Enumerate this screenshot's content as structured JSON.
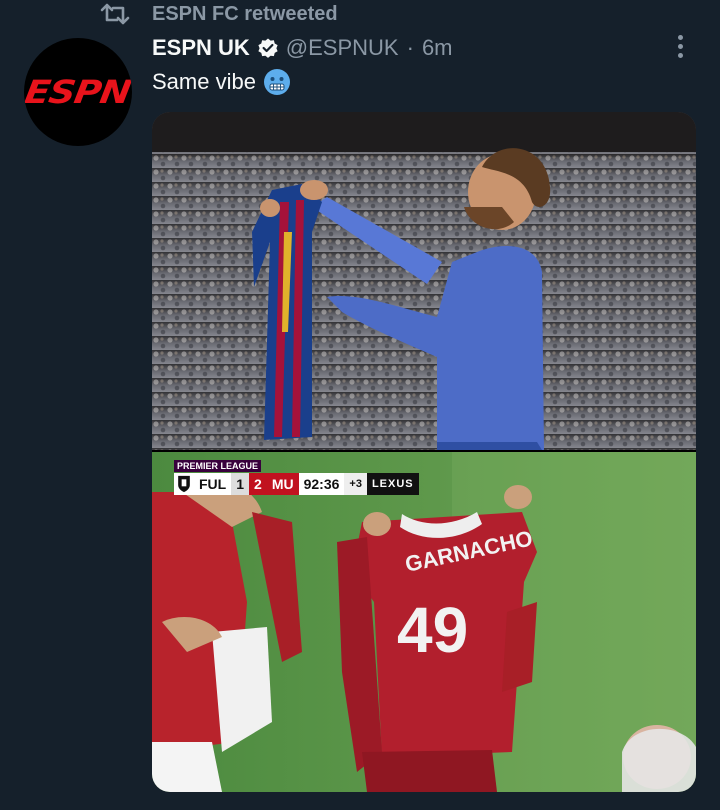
{
  "retweet": {
    "label": "ESPN FC retweeted"
  },
  "author": {
    "avatar_text": "ESPN",
    "display_name": "ESPN UK",
    "handle": "@ESPNUK",
    "separator": "·",
    "time": "6m"
  },
  "tweet": {
    "text": "Same vibe",
    "emoji": "cold-face-emoji"
  },
  "scoreboard": {
    "league": "PREMIER LEAGUE",
    "home": "FUL",
    "home_score": "1",
    "away_score": "2",
    "away": "MU",
    "clock": "92:36",
    "added": "+3",
    "sponsor": "LEXUS"
  },
  "colors": {
    "background": "#15202b",
    "text": "#f7f9f9",
    "secondary": "#8b98a5",
    "verified": "#1d9bf0",
    "espn_red": "#e8131b"
  }
}
